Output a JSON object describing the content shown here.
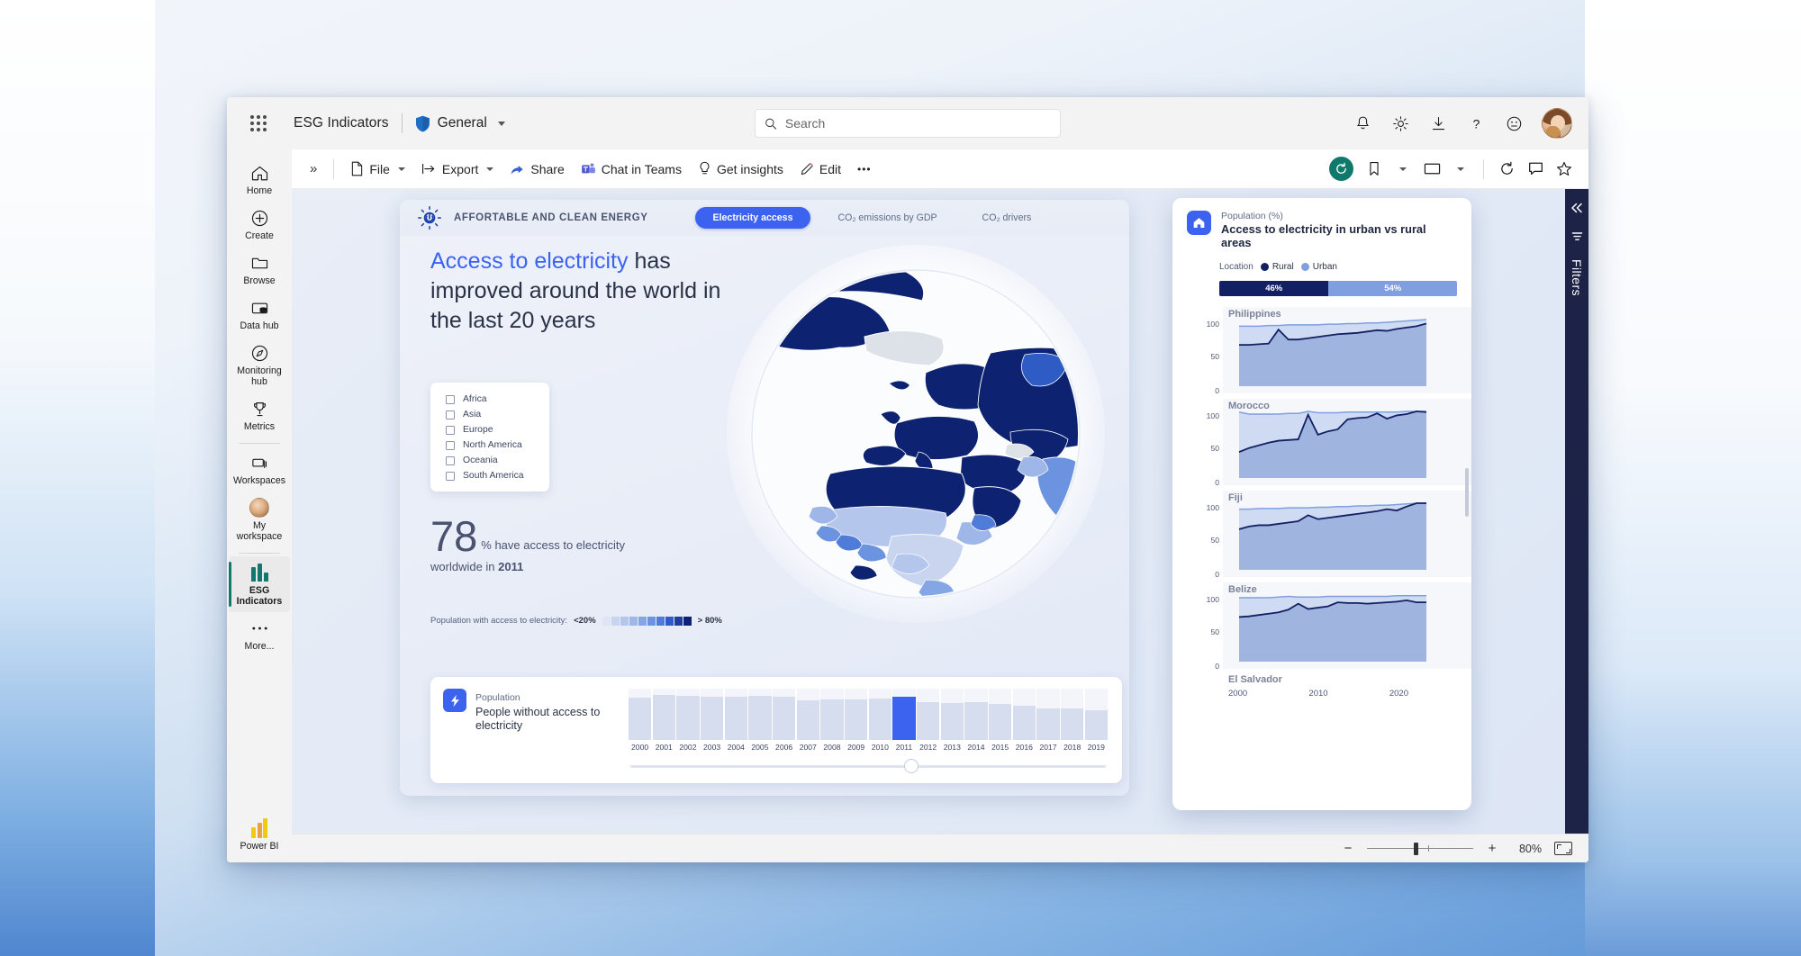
{
  "header": {
    "waffle_icon": "app-launcher-icon",
    "brand": "ESG Indicators",
    "shield_icon": "shield-icon",
    "workspace": "General",
    "workspace_caret": "chevron-down-icon",
    "search_placeholder": "Search",
    "search_value": "",
    "icons": [
      "notification-bell-icon",
      "settings-gear-icon",
      "download-icon",
      "help-question-icon",
      "feedback-smiley-icon"
    ],
    "avatar": "user-avatar"
  },
  "rail": {
    "items": [
      {
        "label": "Home",
        "icon": "home-icon"
      },
      {
        "label": "Create",
        "icon": "plus-circle-icon"
      },
      {
        "label": "Browse",
        "icon": "folder-icon"
      },
      {
        "label": "Data hub",
        "icon": "database-icon"
      },
      {
        "label": "Monitoring hub",
        "icon": "compass-icon"
      },
      {
        "label": "Metrics",
        "icon": "trophy-icon"
      },
      {
        "label": "Workspaces",
        "icon": "workspaces-icon"
      },
      {
        "label": "My workspace",
        "icon": "my-workspace-avatar"
      },
      {
        "label": "ESG Indicators",
        "icon": "esg-bars-icon",
        "selected": true
      },
      {
        "label": "More...",
        "icon": "ellipsis-icon"
      },
      {
        "label": "Power BI",
        "icon": "power-bi-logo"
      }
    ]
  },
  "toolbar": {
    "expand_icon": "double-chevron-right-icon",
    "file": "File",
    "export": "Export",
    "share": "Share",
    "chat_in_teams": "Chat in Teams",
    "get_insights": "Get insights",
    "edit": "Edit",
    "more": "•••",
    "reset_icon": "reset-filters-icon",
    "bookmark_icon": "bookmark-icon",
    "view_icon": "view-window-icon",
    "refresh_icon": "refresh-icon",
    "comment_icon": "comment-icon",
    "favorite_icon": "favorite-star-icon"
  },
  "report": {
    "sdg_icon": "sun-energy-icon",
    "sdg_label": "AFFORTABLE AND CLEAN ENERGY",
    "tabs": [
      {
        "label": "Electricity access",
        "active": true
      },
      {
        "label": "CO₂ emissions by GDP",
        "active": false
      },
      {
        "label": "CO₂ drivers",
        "active": false
      }
    ],
    "headline_highlight": "Access to electricity",
    "headline_rest": " has improved around the world in the last 20 years",
    "continent_filter": {
      "items": [
        "Africa",
        "Asia",
        "Europe",
        "North America",
        "Oceania",
        "South America"
      ]
    },
    "stat": {
      "number": "78",
      "unit_text": "% have access to electricity",
      "sub_prefix": "worldwide in ",
      "sub_year": "2011"
    },
    "map_legend": {
      "label": "Population with access to electricity:",
      "min": "<20%",
      "max": "> 80%",
      "colors": [
        "#dfe5f4",
        "#c9d5ef",
        "#b4c6ec",
        "#9eb7e8",
        "#85a6e4",
        "#6b93e0",
        "#4f7cd8",
        "#2f5cc4",
        "#1c3f9e",
        "#0d2270"
      ]
    }
  },
  "timeline_card": {
    "badge_icon": "bolt-icon",
    "kicker": "Population",
    "title": "People without access to electricity",
    "selected_year": "2011",
    "slider_icon": "slider-handle"
  },
  "side_panel": {
    "badge_icon": "home-icon",
    "kicker": "Population (%)",
    "title": "Access to electricity in urban vs rural areas",
    "legend_label": "Location",
    "legend": [
      {
        "name": "Rural",
        "color": "#122063"
      },
      {
        "name": "Urban",
        "color": "#7f9fe0"
      }
    ],
    "split": [
      {
        "name": "Rural",
        "value": "46%",
        "color": "#122063",
        "pct": 46
      },
      {
        "name": "Urban",
        "value": "54%",
        "color": "#7f9fe0",
        "pct": 54
      }
    ],
    "y_ticks": [
      "100",
      "50",
      "0"
    ],
    "x_ticks": [
      "2000",
      "2010",
      "2020"
    ],
    "partial_next": "El Salvador"
  },
  "filters_rail": {
    "collapse_icon": "double-chevron-left-icon",
    "filter_icon": "filter-icon",
    "label": "Filters"
  },
  "statusbar": {
    "minus": "−",
    "plus": "+",
    "zoom_value": "80%",
    "fit_icon": "fit-to-page-icon"
  },
  "chart_data": [
    {
      "type": "bar",
      "title": "People without access to electricity",
      "categories": [
        "2000",
        "2001",
        "2002",
        "2003",
        "2004",
        "2005",
        "2006",
        "2007",
        "2008",
        "2009",
        "2010",
        "2011",
        "2012",
        "2013",
        "2014",
        "2015",
        "2016",
        "2017",
        "2018",
        "2019"
      ],
      "values": [
        83,
        88,
        86,
        85,
        85,
        86,
        84,
        78,
        79,
        79,
        80,
        84,
        73,
        72,
        73,
        70,
        66,
        62,
        62,
        58
      ],
      "highlight_category": "2011",
      "highlight_color": "#3b63f0",
      "base_color": "#d6ddee",
      "xlabel": "",
      "ylabel": "",
      "ylim": [
        0,
        100
      ],
      "grid": false,
      "legend": "none"
    },
    {
      "type": "area",
      "title": "Philippines",
      "ylabel": "",
      "xlabel": "",
      "ylim": [
        0,
        100
      ],
      "yticks": [
        0,
        50,
        100
      ],
      "x": [
        2000,
        2001,
        2002,
        2003,
        2004,
        2005,
        2006,
        2007,
        2008,
        2009,
        2010,
        2011,
        2012,
        2013,
        2014,
        2015,
        2016,
        2017,
        2018,
        2019
      ],
      "series": [
        {
          "name": "Urban",
          "color": "#7f9fe0",
          "values": [
            90,
            90,
            90,
            91,
            91,
            92,
            92,
            92,
            92,
            93,
            93,
            94,
            94,
            95,
            95,
            96,
            97,
            98,
            99,
            100
          ]
        },
        {
          "name": "Rural",
          "color": "#122063",
          "values": [
            62,
            62,
            63,
            64,
            85,
            70,
            70,
            72,
            74,
            76,
            78,
            79,
            80,
            82,
            84,
            83,
            86,
            88,
            90,
            94
          ]
        }
      ]
    },
    {
      "type": "area",
      "title": "Morocco",
      "ylim": [
        0,
        100
      ],
      "yticks": [
        0,
        50,
        100
      ],
      "x": [
        2000,
        2001,
        2002,
        2003,
        2004,
        2005,
        2006,
        2007,
        2008,
        2009,
        2010,
        2011,
        2012,
        2013,
        2014,
        2015,
        2016,
        2017,
        2018,
        2019
      ],
      "series": [
        {
          "name": "Urban",
          "color": "#7f9fe0",
          "values": [
            99,
            96,
            96,
            96,
            96,
            97,
            97,
            100,
            98,
            98,
            98,
            99,
            99,
            99,
            99,
            99,
            99,
            100,
            100,
            100
          ]
        },
        {
          "name": "Rural",
          "color": "#122063",
          "values": [
            39,
            45,
            49,
            53,
            56,
            57,
            58,
            95,
            65,
            70,
            73,
            88,
            90,
            91,
            97,
            89,
            94,
            96,
            100,
            99
          ]
        }
      ]
    },
    {
      "type": "area",
      "title": "Fiji",
      "ylim": [
        0,
        100
      ],
      "yticks": [
        0,
        50,
        100
      ],
      "x": [
        2000,
        2001,
        2002,
        2003,
        2004,
        2005,
        2006,
        2007,
        2008,
        2009,
        2010,
        2011,
        2012,
        2013,
        2014,
        2015,
        2016,
        2017,
        2018,
        2019
      ],
      "series": [
        {
          "name": "Urban",
          "color": "#7f9fe0",
          "values": [
            91,
            91,
            92,
            92,
            92,
            93,
            93,
            93,
            94,
            94,
            95,
            95,
            96,
            96,
            97,
            97,
            98,
            99,
            100,
            100
          ]
        },
        {
          "name": "Rural",
          "color": "#122063",
          "values": [
            61,
            65,
            67,
            67,
            69,
            71,
            73,
            82,
            76,
            78,
            80,
            82,
            84,
            86,
            88,
            91,
            89,
            95,
            100,
            100
          ]
        }
      ]
    },
    {
      "type": "area",
      "title": "Belize",
      "ylim": [
        0,
        100
      ],
      "yticks": [
        0,
        50,
        100
      ],
      "x": [
        2000,
        2001,
        2002,
        2003,
        2004,
        2005,
        2006,
        2007,
        2008,
        2009,
        2010,
        2011,
        2012,
        2013,
        2014,
        2015,
        2016,
        2017,
        2018,
        2019
      ],
      "series": [
        {
          "name": "Urban",
          "color": "#7f9fe0",
          "values": [
            96,
            96,
            96,
            96,
            97,
            98,
            97,
            97,
            97,
            98,
            98,
            98,
            98,
            98,
            98,
            98,
            99,
            99,
            99,
            99
          ]
        },
        {
          "name": "Rural",
          "color": "#122063",
          "values": [
            67,
            68,
            70,
            72,
            74,
            78,
            87,
            79,
            81,
            83,
            89,
            88,
            88,
            87,
            88,
            89,
            90,
            92,
            89,
            89
          ]
        }
      ]
    }
  ]
}
